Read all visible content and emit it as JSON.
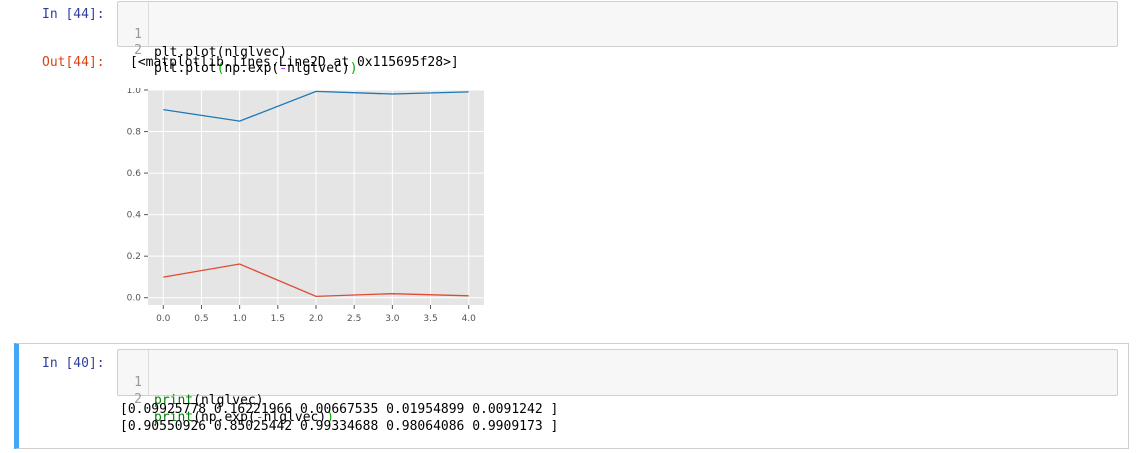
{
  "cell1": {
    "in_prompt": "In [44]:",
    "lines": [
      {
        "num": "1",
        "tokens": [
          {
            "t": "plt.plot(nlglvec)",
            "c": ""
          }
        ]
      },
      {
        "num": "2",
        "tokens": [
          {
            "t": "plt.plot",
            "c": ""
          },
          {
            "t": "(",
            "c": "paren"
          },
          {
            "t": "np.exp(",
            "c": ""
          },
          {
            "t": "-",
            "c": "op"
          },
          {
            "t": "nlglvec)",
            "c": ""
          },
          {
            "t": ")",
            "c": "paren"
          }
        ]
      }
    ],
    "out_prompt": "Out[44]:",
    "out_text": "[<matplotlib.lines.Line2D at 0x115695f28>]"
  },
  "chart_data": {
    "type": "line",
    "x": [
      0,
      1,
      2,
      3,
      4
    ],
    "series": [
      {
        "values": [
          0.90550926,
          0.85025442,
          0.99334688,
          0.98064086,
          0.9909173
        ],
        "color": "#1f77b4"
      },
      {
        "values": [
          0.09925778,
          0.16221966,
          0.00667535,
          0.01954899,
          0.0091242
        ],
        "color": "#e24a33"
      }
    ],
    "xticks": [
      "0.0",
      "0.5",
      "1.0",
      "1.5",
      "2.0",
      "2.5",
      "3.0",
      "3.5",
      "4.0"
    ],
    "xtick_values": [
      0,
      0.5,
      1,
      1.5,
      2,
      2.5,
      3,
      3.5,
      4
    ],
    "yticks": [
      "0.0",
      "0.2",
      "0.4",
      "0.6",
      "0.8",
      "1.0"
    ],
    "ytick_values": [
      0,
      0.2,
      0.4,
      0.6,
      0.8,
      1.0
    ],
    "xlim": [
      -0.2,
      4.2
    ],
    "ylim": [
      -0.035,
      1.0
    ],
    "grid": true,
    "background": "#e5e5e5"
  },
  "cell2": {
    "in_prompt": "In [40]:",
    "lines": [
      {
        "num": "1",
        "tokens": [
          {
            "t": "print",
            "c": "builtin"
          },
          {
            "t": "(nlglvec)",
            "c": ""
          }
        ]
      },
      {
        "num": "2",
        "tokens": [
          {
            "t": "print",
            "c": "builtin"
          },
          {
            "t": "(np.exp(",
            "c": ""
          },
          {
            "t": "-",
            "c": "op"
          },
          {
            "t": "nlglvec)",
            "c": ""
          },
          {
            "t": ")",
            "c": "paren"
          }
        ]
      }
    ],
    "out_lines": [
      "[0.09925778 0.16221966 0.00667535 0.01954899 0.0091242 ]",
      "[0.90550926 0.85025442 0.99334688 0.98064086 0.9909173 ]"
    ],
    "accent_color": "#42a5f5"
  }
}
